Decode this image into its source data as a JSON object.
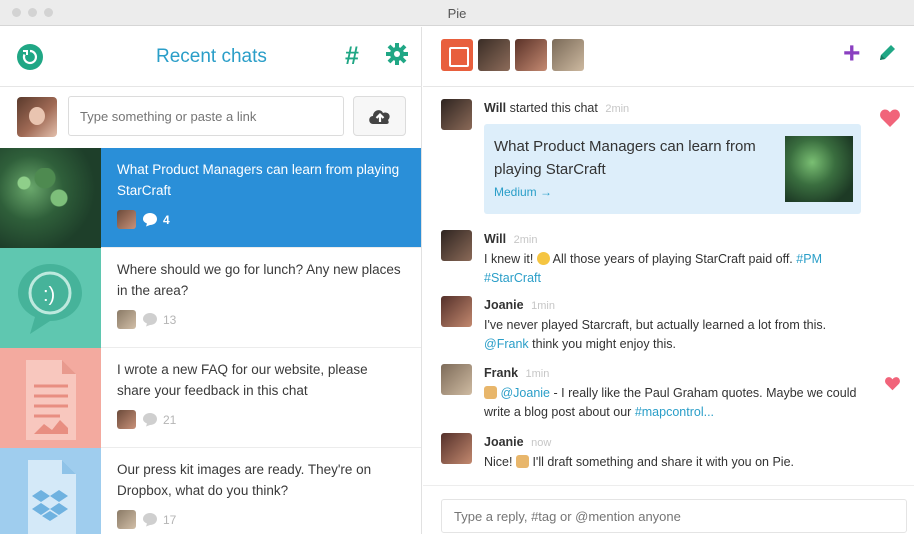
{
  "window": {
    "title": "Pie"
  },
  "left": {
    "title": "Recent chats",
    "icons": [
      "back-icon",
      "hash-icon",
      "gear-icon"
    ],
    "compose": {
      "placeholder": "Type something or paste a link",
      "upload_icon": "cloud-upload-icon"
    },
    "chats": [
      {
        "text": "What Product Managers can learn from playing StarCraft",
        "count": "4",
        "thumb": "game",
        "active": true
      },
      {
        "text": "Where should we go for lunch? Any new places in the area?",
        "count": "13",
        "thumb": "teal",
        "active": false
      },
      {
        "text": "I wrote a new FAQ for our website, please share your feedback in this chat",
        "count": "21",
        "thumb": "salmon",
        "active": false
      },
      {
        "text": "Our press kit images are ready. They're on Dropbox, what do you think?",
        "count": "17",
        "thumb": "blue",
        "active": false
      }
    ]
  },
  "right": {
    "header_icons": [
      "plus-icon",
      "pencil-icon"
    ],
    "messages": {
      "started": {
        "author": "Will",
        "text": "started this chat",
        "time": "2min"
      },
      "link": {
        "title": "What Product Managers can learn from playing StarCraft",
        "source": "Medium →"
      },
      "m1": {
        "author": "Will",
        "time": "2min",
        "before": "I knew it!",
        "after": "All those years of playing StarCraft paid off.",
        "tag1": "#PM",
        "tag2": "#StarCraft"
      },
      "m2": {
        "author": "Joanie",
        "time": "1min",
        "text": "I've never played Starcraft, but actually learned a lot from this.",
        "mention": "@Frank",
        "after": "think you might enjoy this."
      },
      "m3": {
        "author": "Frank",
        "time": "1min",
        "mention": "@Joanie",
        "text": "- I really like the Paul Graham quotes. Maybe we could write a blog post about our",
        "tag": "#mapcontrol..."
      },
      "m4": {
        "author": "Joanie",
        "time": "now",
        "before": "Nice!",
        "after": "I'll draft something and share it with you on Pie."
      }
    },
    "reply_placeholder": "Type a reply, #tag or @mention anyone"
  },
  "colors": {
    "accent_green": "#20a785",
    "accent_blue": "#2a9ec8",
    "active_row": "#2a8fd8",
    "heart": "#f1647a",
    "plus": "#8a3fc0"
  }
}
